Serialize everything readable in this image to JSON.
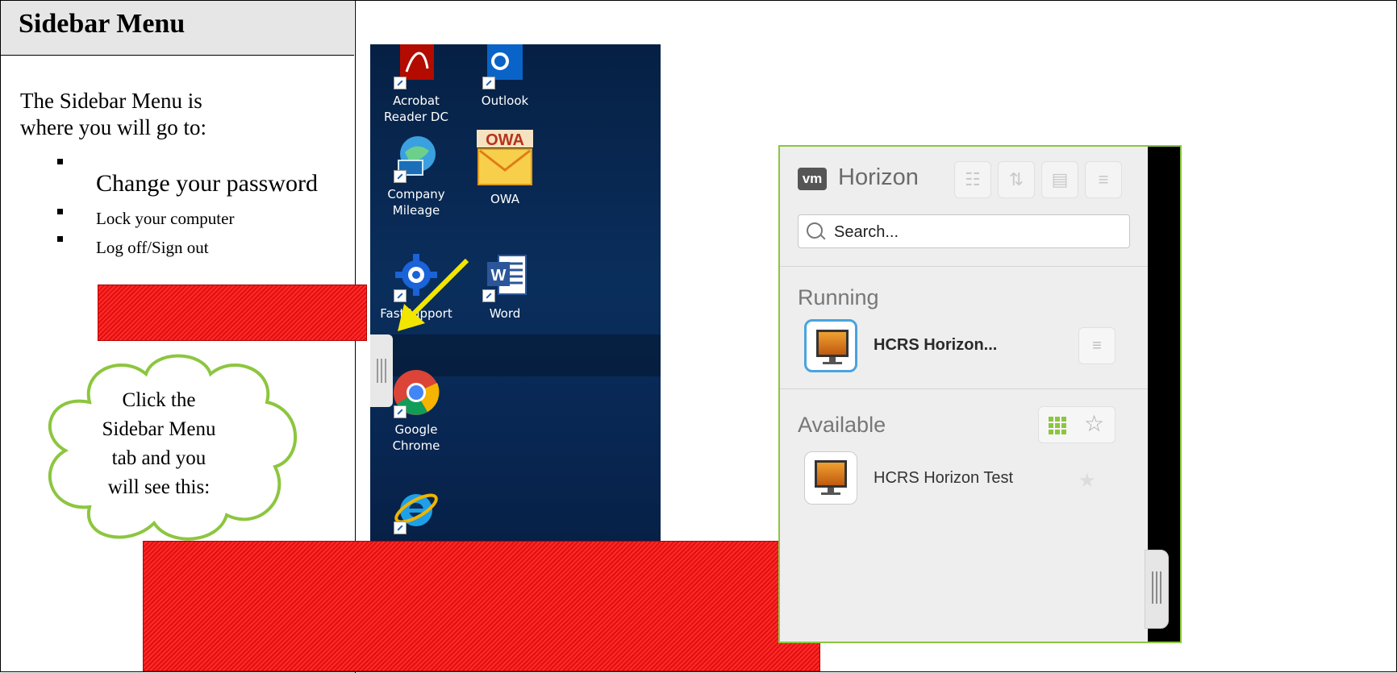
{
  "left_panel": {
    "heading": "Sidebar Menu",
    "intro_line1": "The Sidebar Menu is",
    "intro_line2": "where you will go to:",
    "bullets": [
      "Change your password",
      "Lock your computer",
      "Log off/Sign out"
    ]
  },
  "callout": {
    "line1": "Click the",
    "line2": "Sidebar Menu",
    "line3": "tab and you",
    "line4": "will see this:"
  },
  "desktop": {
    "icons": [
      {
        "label1": "Acrobat",
        "label2": "Reader DC",
        "icon": "acrobat-icon"
      },
      {
        "label1": "Outlook",
        "label2": "",
        "icon": "outlook-icon"
      },
      {
        "label1": "Company",
        "label2": "Mileage",
        "icon": "globe-icon"
      },
      {
        "label1": "OWA",
        "label2": "",
        "icon": "owa-icon"
      },
      {
        "label1": "FastSupport",
        "label2": "",
        "icon": "gear-icon"
      },
      {
        "label1": "Word",
        "label2": "",
        "icon": "word-icon"
      },
      {
        "label1": "Google",
        "label2": "Chrome",
        "icon": "chrome-icon"
      }
    ]
  },
  "horizon": {
    "logo": "vm",
    "title": "Horizon",
    "search_placeholder": "Search...",
    "sections": {
      "running": "Running",
      "available": "Available"
    },
    "running_apps": [
      "HCRS Horizon..."
    ],
    "available_apps": [
      "HCRS Horizon Test"
    ],
    "accent_color": "#8cc63f",
    "selected_color": "#4aa3df"
  }
}
